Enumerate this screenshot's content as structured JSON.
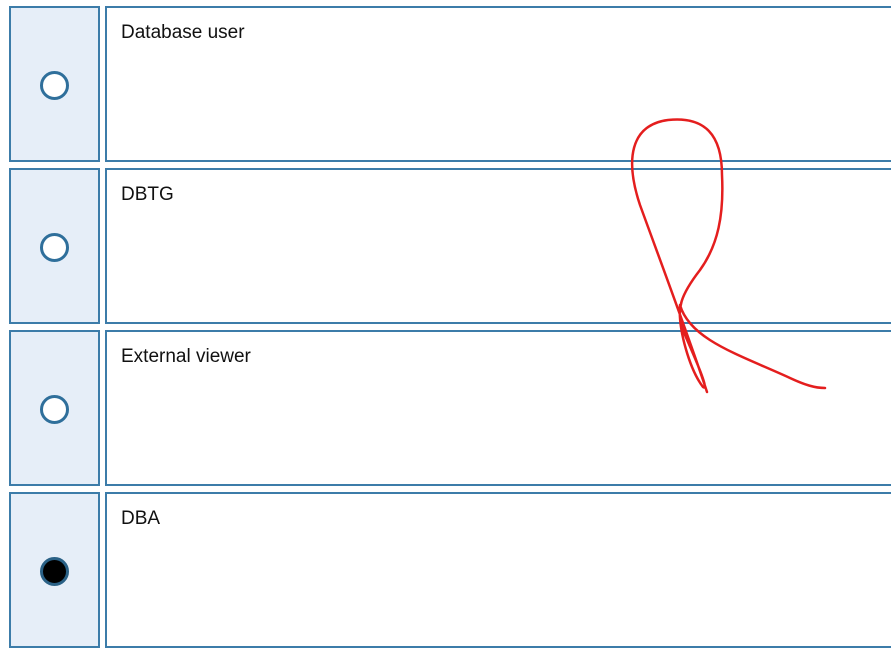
{
  "options": [
    {
      "label": "Database user",
      "selected": false
    },
    {
      "label": "DBTG",
      "selected": false
    },
    {
      "label": "External viewer",
      "selected": false
    },
    {
      "label": "DBA",
      "selected": true
    }
  ],
  "colors": {
    "border": "#3c7ca9",
    "radio_cell_bg": "#e6eef8",
    "radio_ring": "#2f6f9b",
    "annotation": "#e41e1e"
  }
}
